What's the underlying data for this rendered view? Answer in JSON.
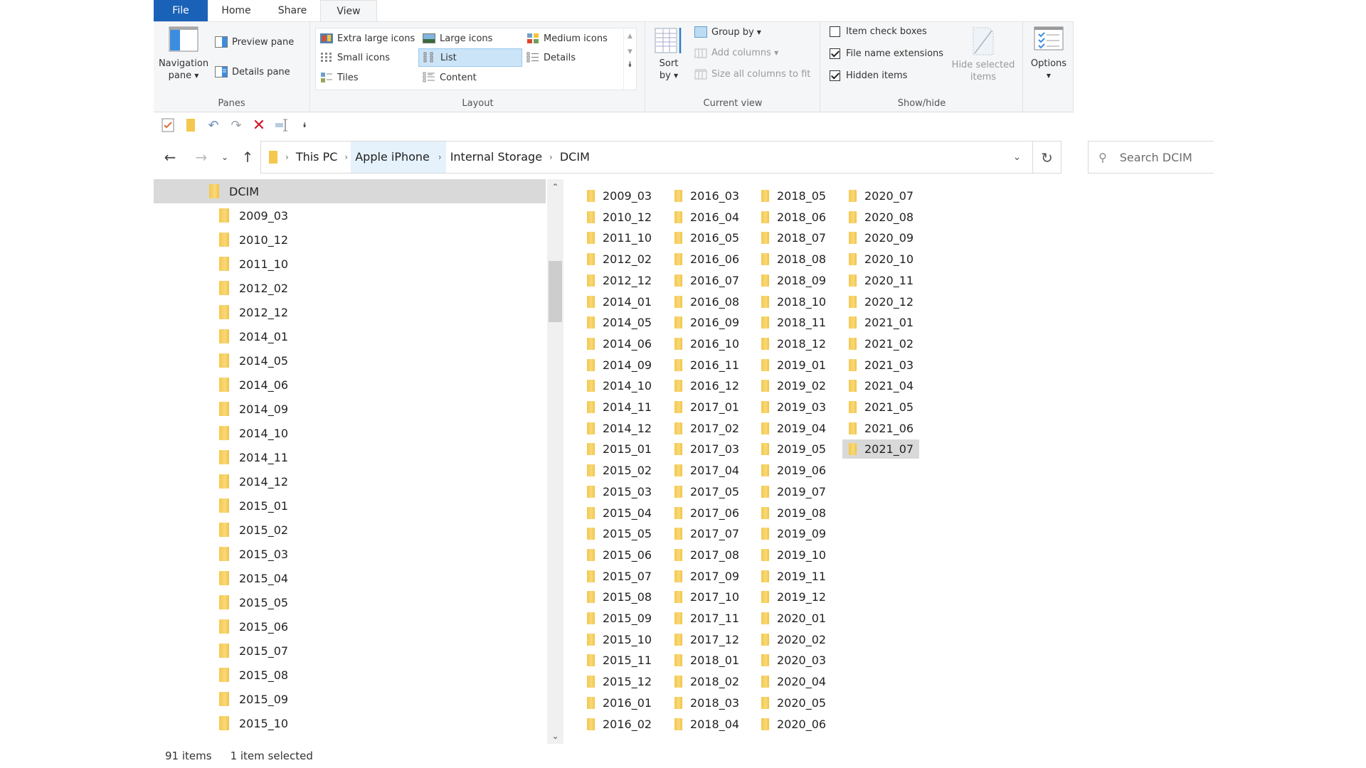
{
  "ribbon": {
    "tabs": [
      {
        "label": "File",
        "active": false
      },
      {
        "label": "Home",
        "active": false
      },
      {
        "label": "Share",
        "active": false
      },
      {
        "label": "View",
        "active": true
      }
    ],
    "panes": {
      "label": "Panes",
      "navigation_pane": "Navigation",
      "navigation_pane_2": "pane",
      "preview_pane": "Preview pane",
      "details_pane": "Details pane"
    },
    "layout": {
      "label": "Layout",
      "options": [
        {
          "label": "Extra large icons",
          "selected": false
        },
        {
          "label": "Large icons",
          "selected": false
        },
        {
          "label": "Medium icons",
          "selected": false
        },
        {
          "label": "Small icons",
          "selected": false
        },
        {
          "label": "List",
          "selected": true
        },
        {
          "label": "Details",
          "selected": false
        },
        {
          "label": "Tiles",
          "selected": false
        },
        {
          "label": "Content",
          "selected": false
        }
      ]
    },
    "current_view": {
      "label": "Current view",
      "sort_by_1": "Sort",
      "sort_by_2": "by",
      "group_by": "Group by",
      "add_columns": "Add columns",
      "size_columns": "Size all columns to fit"
    },
    "show_hide": {
      "label": "Show/hide",
      "item_check_boxes": {
        "label": "Item check boxes",
        "checked": false
      },
      "file_name_extensions": {
        "label": "File name extensions",
        "checked": true
      },
      "hidden_items": {
        "label": "Hidden items",
        "checked": true
      },
      "hide_selected_1": "Hide selected",
      "hide_selected_2": "items"
    },
    "options": {
      "label": "Options"
    }
  },
  "address": {
    "breadcrumbs": [
      "This PC",
      "Apple iPhone",
      "Internal Storage",
      "DCIM"
    ],
    "search_placeholder": "Search DCIM"
  },
  "nav_pane": {
    "root": "DCIM",
    "items": [
      "2009_03",
      "2010_12",
      "2011_10",
      "2012_02",
      "2012_12",
      "2014_01",
      "2014_05",
      "2014_06",
      "2014_09",
      "2014_10",
      "2014_11",
      "2014_12",
      "2015_01",
      "2015_02",
      "2015_03",
      "2015_04",
      "2015_05",
      "2015_06",
      "2015_07",
      "2015_08",
      "2015_09",
      "2015_10"
    ],
    "scroll_position": 0.14
  },
  "content": {
    "columns": [
      [
        "2009_03",
        "2010_12",
        "2011_10",
        "2012_02",
        "2012_12",
        "2014_01",
        "2014_05",
        "2014_06",
        "2014_09",
        "2014_10",
        "2014_11",
        "2014_12",
        "2015_01",
        "2015_02",
        "2015_03",
        "2015_04",
        "2015_05",
        "2015_06",
        "2015_07",
        "2015_08",
        "2015_09",
        "2015_10",
        "2015_11",
        "2015_12",
        "2016_01",
        "2016_02"
      ],
      [
        "2016_03",
        "2016_04",
        "2016_05",
        "2016_06",
        "2016_07",
        "2016_08",
        "2016_09",
        "2016_10",
        "2016_11",
        "2016_12",
        "2017_01",
        "2017_02",
        "2017_03",
        "2017_04",
        "2017_05",
        "2017_06",
        "2017_07",
        "2017_08",
        "2017_09",
        "2017_10",
        "2017_11",
        "2017_12",
        "2018_01",
        "2018_02",
        "2018_03",
        "2018_04"
      ],
      [
        "2018_05",
        "2018_06",
        "2018_07",
        "2018_08",
        "2018_09",
        "2018_10",
        "2018_11",
        "2018_12",
        "2019_01",
        "2019_02",
        "2019_03",
        "2019_04",
        "2019_05",
        "2019_06",
        "2019_07",
        "2019_08",
        "2019_09",
        "2019_10",
        "2019_11",
        "2019_12",
        "2020_01",
        "2020_02",
        "2020_03",
        "2020_04",
        "2020_05",
        "2020_06"
      ],
      [
        "2020_07",
        "2020_08",
        "2020_09",
        "2020_10",
        "2020_11",
        "2020_12",
        "2021_01",
        "2021_02",
        "2021_03",
        "2021_04",
        "2021_05",
        "2021_06",
        "2021_07"
      ]
    ],
    "selected": "2021_07"
  },
  "status": {
    "item_count": "91 items",
    "selection": "1 item selected"
  },
  "colors": {
    "file_tab": "#1a62b8",
    "selection": "#d9d9d9",
    "layout_selected": "#cce4f7",
    "folder": "#f4c84f"
  }
}
